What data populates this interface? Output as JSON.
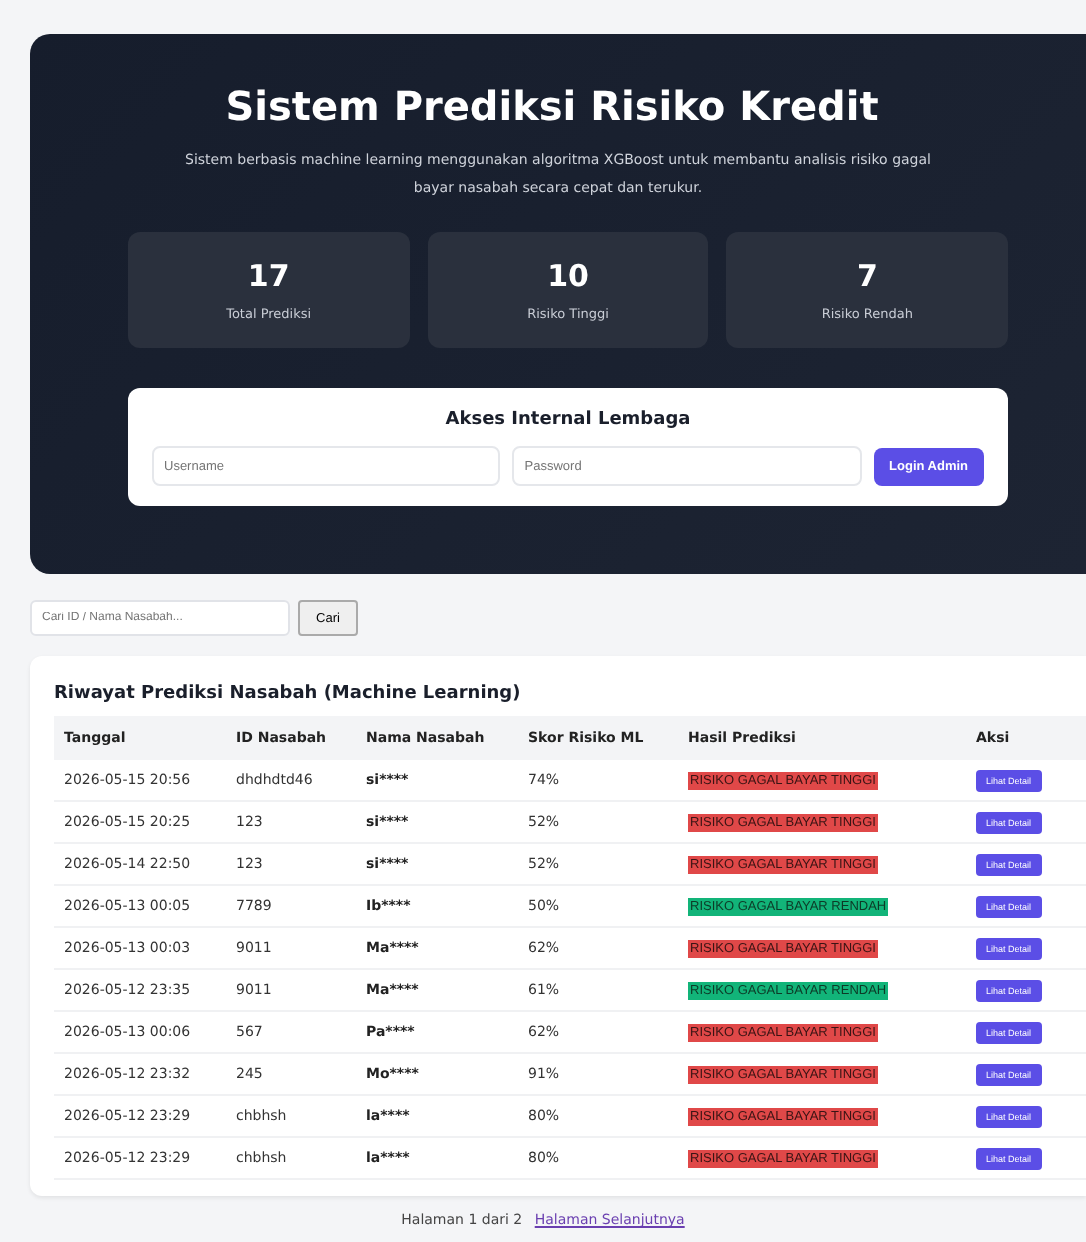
{
  "hero": {
    "title": "Sistem Prediksi Risiko Kredit",
    "subtitle": "Sistem berbasis machine learning menggunakan algoritma XGBoost untuk membantu analisis risiko gagal bayar nasabah secara cepat dan terukur.",
    "stats": [
      {
        "value": "17",
        "label": "Total Prediksi"
      },
      {
        "value": "10",
        "label": "Risiko Tinggi"
      },
      {
        "value": "7",
        "label": "Risiko Rendah"
      }
    ],
    "login": {
      "title": "Akses Internal Lembaga",
      "username": {
        "placeholder": "Username"
      },
      "password": {
        "placeholder": "Password"
      },
      "button": "Login Admin"
    }
  },
  "search": {
    "placeholder": "Cari ID / Nama Nasabah...",
    "button": "Cari"
  },
  "table": {
    "title": "Riwayat Prediksi Nasabah (Machine Learning)",
    "columns": [
      "Tanggal",
      "ID Nasabah",
      "Nama Nasabah",
      "Skor Risiko ML",
      "Hasil Prediksi",
      "Aksi"
    ],
    "rows": [
      {
        "date": "2026-05-15 20:56",
        "id": "dhdhdtd46",
        "name": "si****",
        "score": "74%",
        "result": "RISIKO GAGAL BAYAR TINGGI",
        "kind": "high",
        "action": "Lihat Detail"
      },
      {
        "date": "2026-05-15 20:25",
        "id": "123",
        "name": "si****",
        "score": "52%",
        "result": "RISIKO GAGAL BAYAR TINGGI",
        "kind": "high",
        "action": "Lihat Detail"
      },
      {
        "date": "2026-05-14 22:50",
        "id": "123",
        "name": "si****",
        "score": "52%",
        "result": "RISIKO GAGAL BAYAR TINGGI",
        "kind": "high",
        "action": "Lihat Detail"
      },
      {
        "date": "2026-05-13 00:05",
        "id": "7789",
        "name": "Ib****",
        "score": "50%",
        "result": "RISIKO GAGAL BAYAR RENDAH",
        "kind": "low",
        "action": "Lihat Detail"
      },
      {
        "date": "2026-05-13 00:03",
        "id": "9011",
        "name": "Ma****",
        "score": "62%",
        "result": "RISIKO GAGAL BAYAR TINGGI",
        "kind": "high",
        "action": "Lihat Detail"
      },
      {
        "date": "2026-05-12 23:35",
        "id": "9011",
        "name": "Ma****",
        "score": "61%",
        "result": "RISIKO GAGAL BAYAR RENDAH",
        "kind": "low",
        "action": "Lihat Detail"
      },
      {
        "date": "2026-05-13 00:06",
        "id": "567",
        "name": "Pa****",
        "score": "62%",
        "result": "RISIKO GAGAL BAYAR TINGGI",
        "kind": "high",
        "action": "Lihat Detail"
      },
      {
        "date": "2026-05-12 23:32",
        "id": "245",
        "name": "Mo****",
        "score": "91%",
        "result": "RISIKO GAGAL BAYAR TINGGI",
        "kind": "high",
        "action": "Lihat Detail"
      },
      {
        "date": "2026-05-12 23:29",
        "id": "chbhsh",
        "name": "la****",
        "score": "80%",
        "result": "RISIKO GAGAL BAYAR TINGGI",
        "kind": "high",
        "action": "Lihat Detail"
      },
      {
        "date": "2026-05-12 23:29",
        "id": "chbhsh",
        "name": "la****",
        "score": "80%",
        "result": "RISIKO GAGAL BAYAR TINGGI",
        "kind": "high",
        "action": "Lihat Detail"
      }
    ]
  },
  "pagination": {
    "text": "Halaman 1 dari 2",
    "link": "Halaman Selanjutnya"
  }
}
